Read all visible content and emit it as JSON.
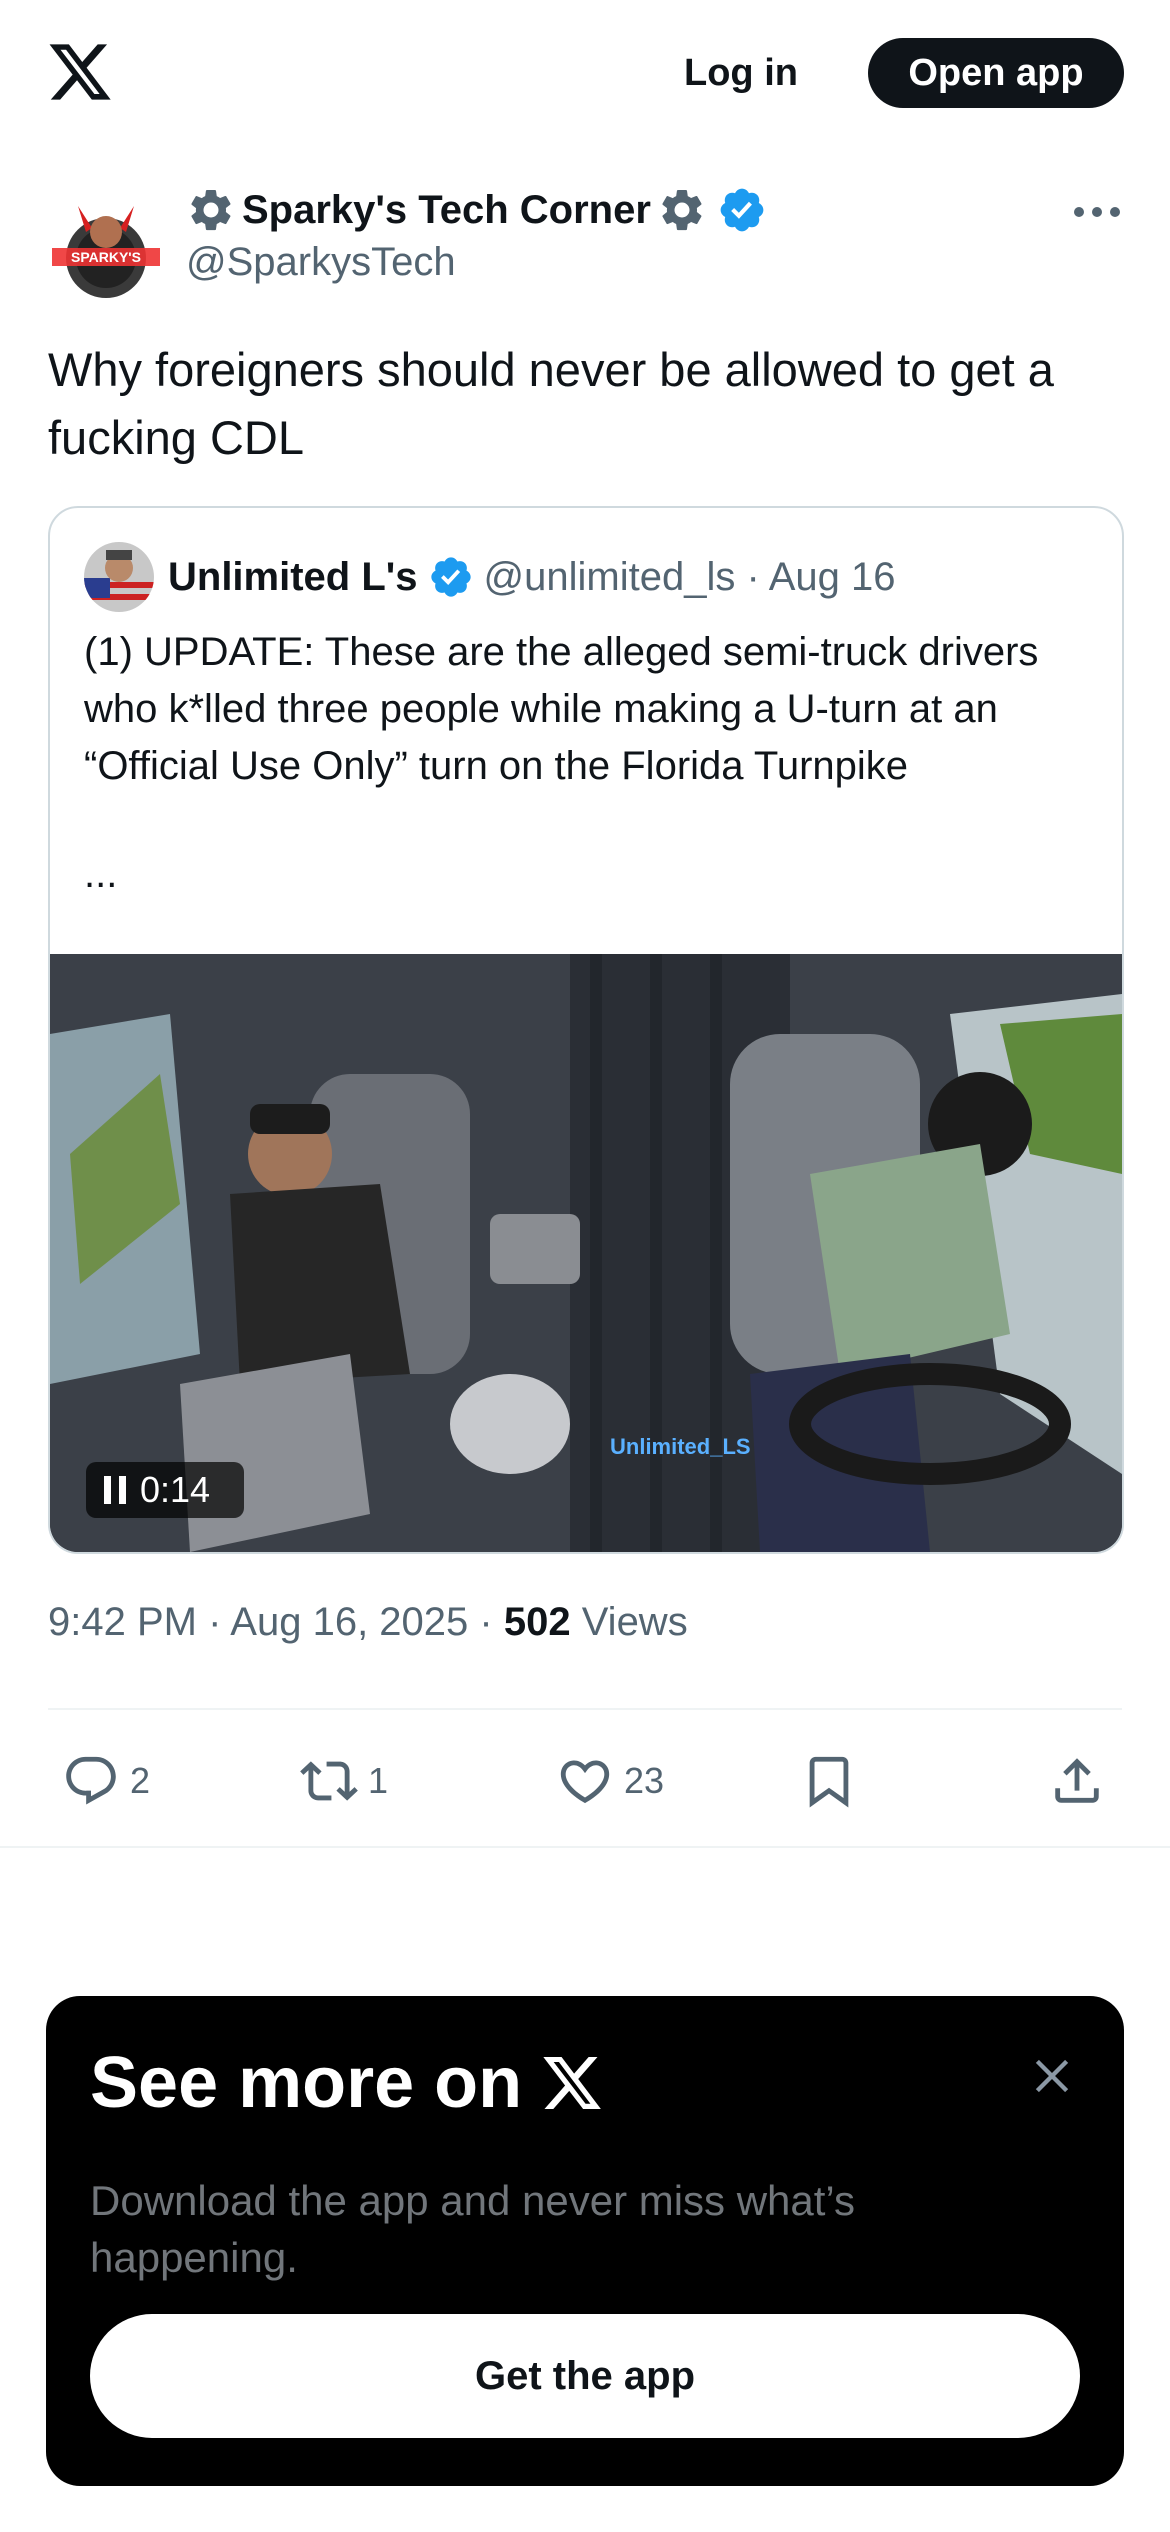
{
  "topbar": {
    "logo_icon": "x-logo-icon",
    "login_label": "Log in",
    "open_app_label": "Open app"
  },
  "tweet": {
    "author_name": "Sparky's Tech Corner",
    "author_handle": "@SparkysTech",
    "avatar_text": "SPARKY'S",
    "text": "Why foreigners should never be allowed to get a fucking CDL",
    "timestamp": "9:42 PM · Aug 16, 2025 · ",
    "views_count": "502",
    "views_label": "Views"
  },
  "quote": {
    "name": "Unlimited L's",
    "handle_date": "@unlimited_ls · Aug 16",
    "text": "(1) UPDATE: These are the alleged semi-truck drivers who k*lled three people while making a U-turn at an “Official Use Only” turn on the Florida Turnpike",
    "ellipsis": "...",
    "video_watermark": "Unlimited_LS",
    "video_time": "0:14"
  },
  "actions": {
    "replies": "2",
    "retweets": "1",
    "likes": "23"
  },
  "promo": {
    "title": "See more on",
    "subtitle": "Download the app and never miss what’s happening.",
    "button_label": "Get the app"
  },
  "colors": {
    "verified": "#1d9bf0",
    "text_primary": "#0f1419",
    "text_secondary": "#536471"
  }
}
